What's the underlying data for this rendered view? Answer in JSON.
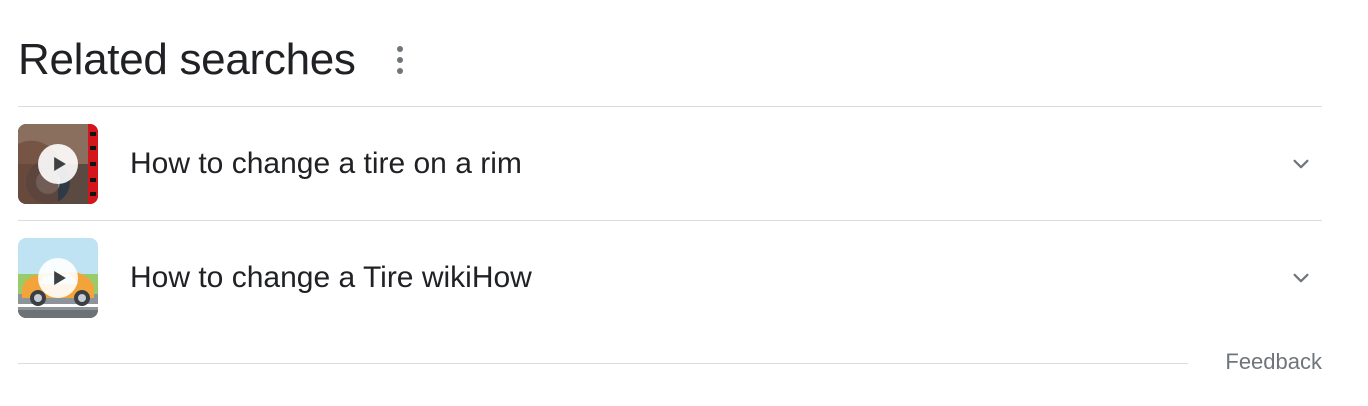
{
  "header": {
    "title": "Related searches"
  },
  "items": [
    {
      "label": "How to change a tire on a rim",
      "thumbnail": "tire-rim-video-thumbnail"
    },
    {
      "label": "How to change a Tire wikiHow",
      "thumbnail": "wikihow-car-video-thumbnail"
    }
  ],
  "footer": {
    "feedback_label": "Feedback"
  },
  "icons": {
    "more": "more-vert-icon",
    "play": "play-icon",
    "expand": "chevron-down-icon"
  },
  "colors": {
    "text": "#202124",
    "muted": "#70757a",
    "divider": "#dadce0"
  }
}
